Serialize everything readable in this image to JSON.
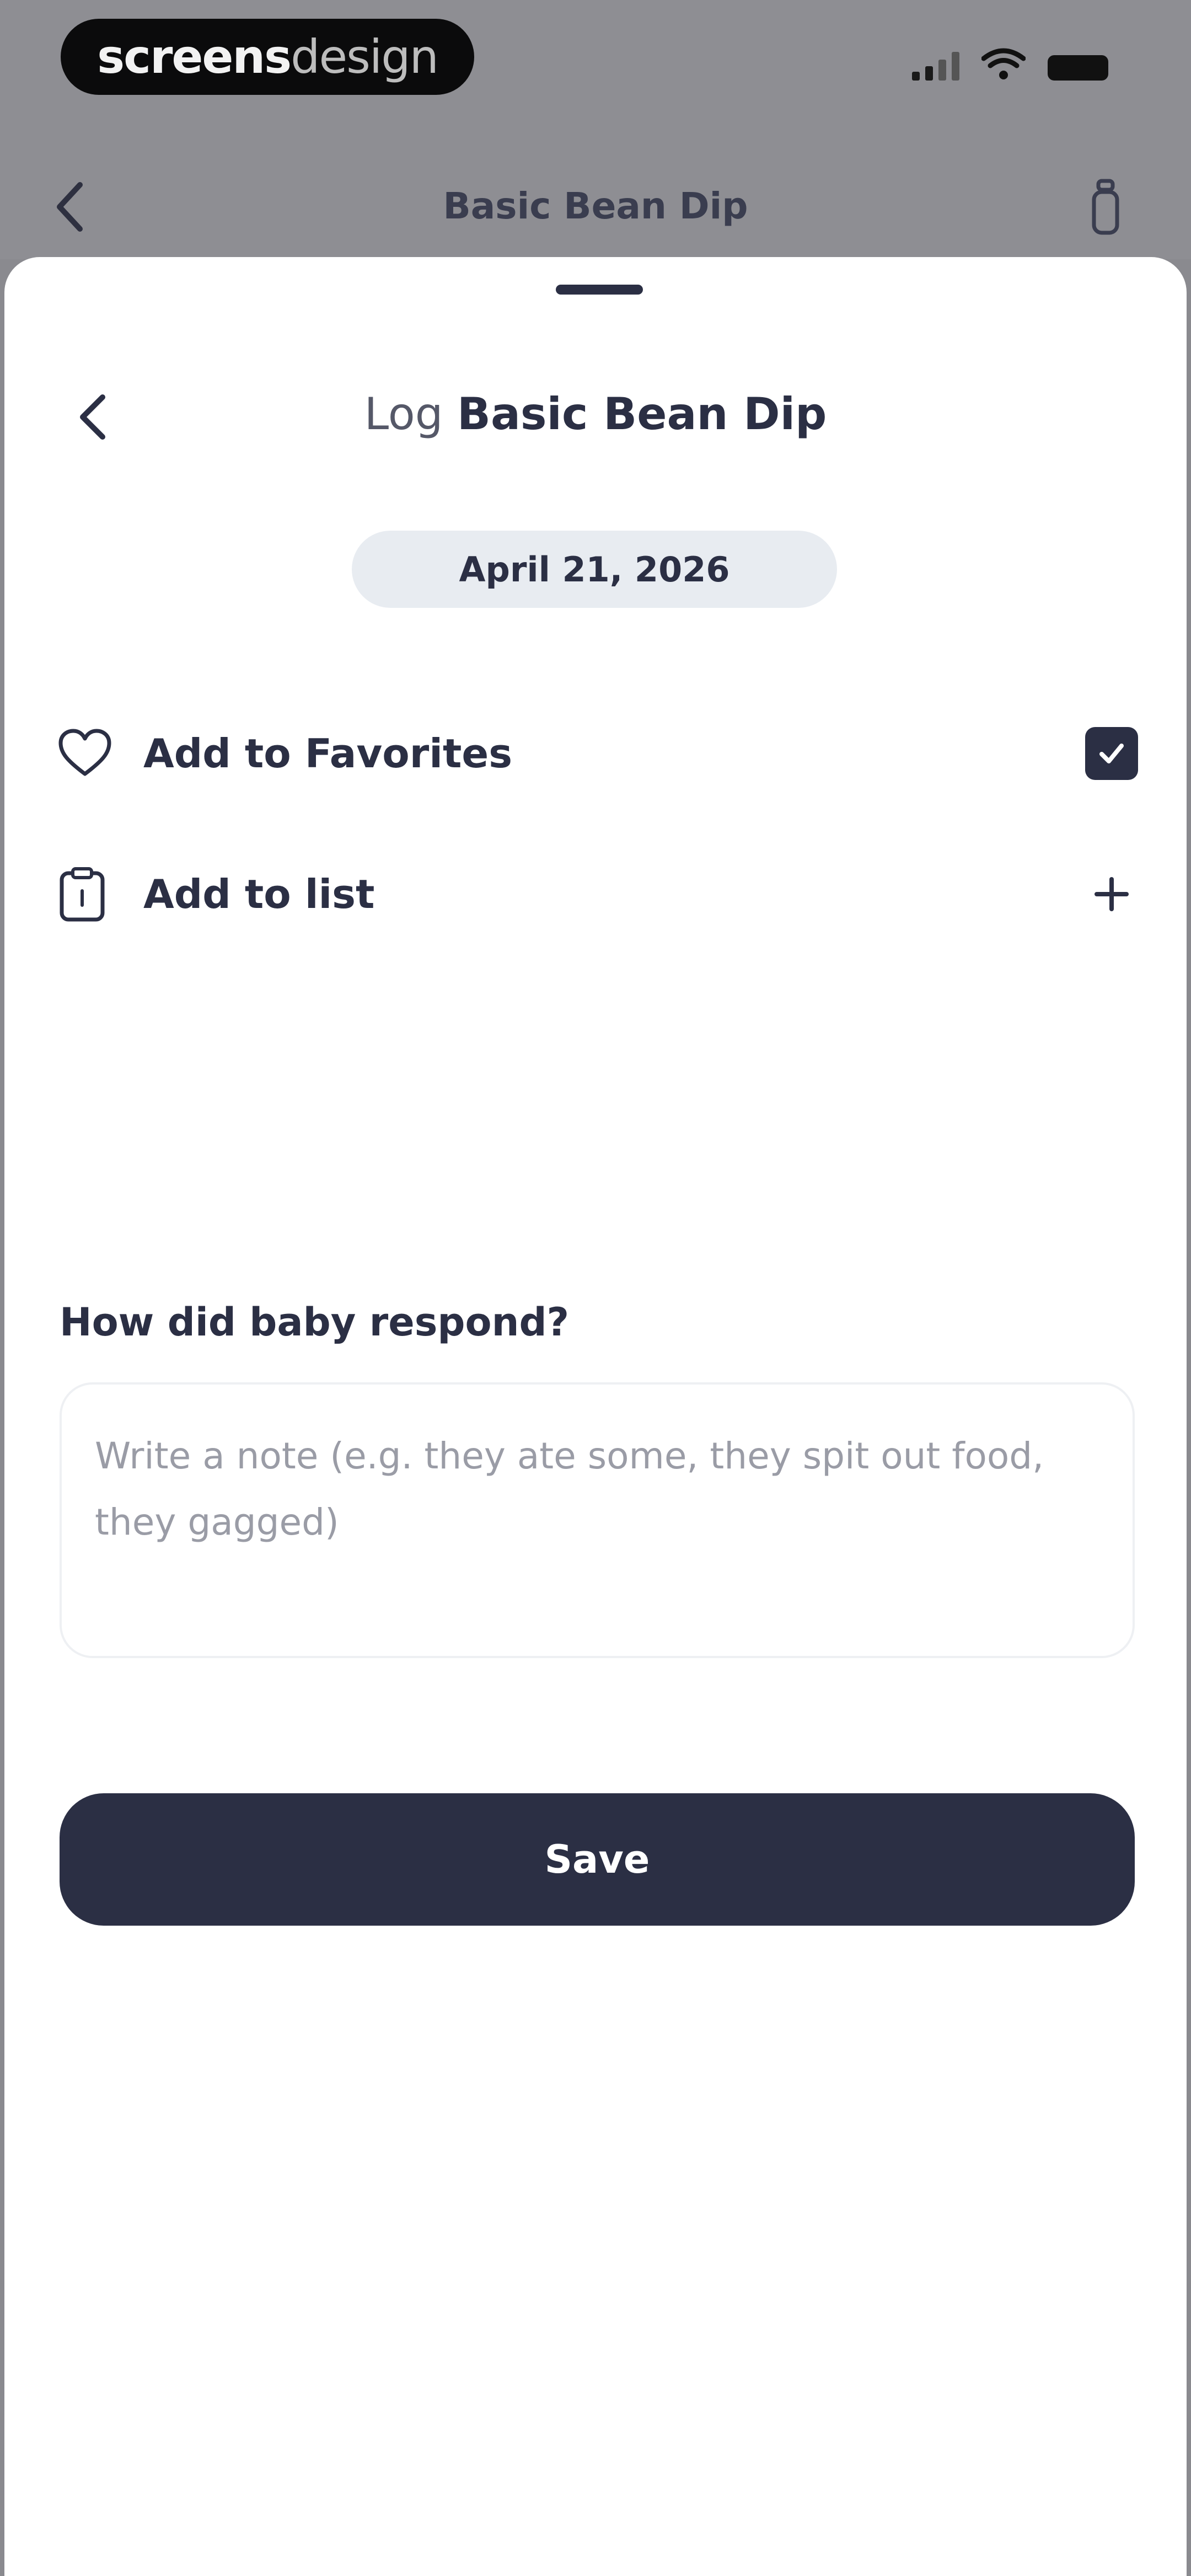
{
  "status_bar": {
    "brand_part1": "screens",
    "brand_part2": "design"
  },
  "background_page": {
    "title": "Basic Bean Dip"
  },
  "sheet": {
    "title_prefix": "Log",
    "title_name": "Basic Bean Dip",
    "date": "April 21, 2026",
    "favorites_label": "Add to Favorites",
    "favorites_checked": true,
    "list_label": "Add to list",
    "question": "How did baby respond?",
    "note_placeholder": "Write a note (e.g. they ate some, they spit out food, they gagged)",
    "save_label": "Save"
  },
  "colors": {
    "primary": "#2b2f44",
    "chip_bg": "#e8ecf1",
    "overlay": "#8e8e93"
  }
}
